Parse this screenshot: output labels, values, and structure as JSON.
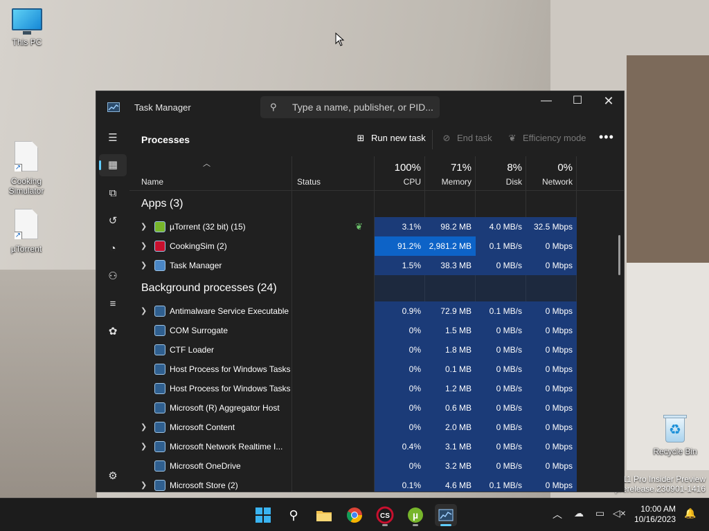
{
  "desktop": {
    "icons": [
      {
        "label": "This PC"
      },
      {
        "label": "Cooking Simulator"
      },
      {
        "label": "µTorrent"
      },
      {
        "label": "Recycle Bin"
      }
    ],
    "watermark": {
      "line1": "11 Pro Insider Preview",
      "line2": "prerelease.230901-1416"
    }
  },
  "window": {
    "title": "Task Manager",
    "search_placeholder": "Type a name, publisher, or PID...",
    "page_title": "Processes",
    "toolbar": {
      "run_new_task": "Run new task",
      "end_task": "End task",
      "efficiency_mode": "Efficiency mode",
      "more": "•••"
    },
    "columns": {
      "name": "Name",
      "status": "Status",
      "cpu": {
        "pct": "100%",
        "label": "CPU"
      },
      "memory": {
        "pct": "71%",
        "label": "Memory"
      },
      "disk": {
        "pct": "8%",
        "label": "Disk"
      },
      "network": {
        "pct": "0%",
        "label": "Network"
      }
    },
    "groups": {
      "apps": "Apps (3)",
      "background": "Background processes (24)"
    },
    "apps": [
      {
        "name": "µTorrent (32 bit) (15)",
        "cpu": "3.1%",
        "mem": "98.2 MB",
        "disk": "4.0 MB/s",
        "net": "32.5 Mbps",
        "expand": true,
        "eco": true,
        "icon_color": "#77b52b"
      },
      {
        "name": "CookingSim (2)",
        "cpu": "91.2%",
        "mem": "2,981.2 MB",
        "disk": "0.1 MB/s",
        "net": "0 Mbps",
        "expand": true,
        "eco": false,
        "icon_color": "#c8102e"
      },
      {
        "name": "Task Manager",
        "cpu": "1.5%",
        "mem": "38.3 MB",
        "disk": "0 MB/s",
        "net": "0 Mbps",
        "expand": true,
        "eco": false,
        "icon_color": "#4a86c5"
      }
    ],
    "background": [
      {
        "name": "Antimalware Service Executable",
        "cpu": "0.9%",
        "mem": "72.9 MB",
        "disk": "0.1 MB/s",
        "net": "0 Mbps",
        "expand": true
      },
      {
        "name": "COM Surrogate",
        "cpu": "0%",
        "mem": "1.5 MB",
        "disk": "0 MB/s",
        "net": "0 Mbps",
        "expand": false
      },
      {
        "name": "CTF Loader",
        "cpu": "0%",
        "mem": "1.8 MB",
        "disk": "0 MB/s",
        "net": "0 Mbps",
        "expand": false
      },
      {
        "name": "Host Process for Windows Tasks",
        "cpu": "0%",
        "mem": "0.1 MB",
        "disk": "0 MB/s",
        "net": "0 Mbps",
        "expand": false
      },
      {
        "name": "Host Process for Windows Tasks",
        "cpu": "0%",
        "mem": "1.2 MB",
        "disk": "0 MB/s",
        "net": "0 Mbps",
        "expand": false
      },
      {
        "name": "Microsoft (R) Aggregator Host",
        "cpu": "0%",
        "mem": "0.6 MB",
        "disk": "0 MB/s",
        "net": "0 Mbps",
        "expand": false
      },
      {
        "name": "Microsoft Content",
        "cpu": "0%",
        "mem": "2.0 MB",
        "disk": "0 MB/s",
        "net": "0 Mbps",
        "expand": true
      },
      {
        "name": "Microsoft Network Realtime I...",
        "cpu": "0.4%",
        "mem": "3.1 MB",
        "disk": "0 MB/s",
        "net": "0 Mbps",
        "expand": true
      },
      {
        "name": "Microsoft OneDrive",
        "cpu": "0%",
        "mem": "3.2 MB",
        "disk": "0 MB/s",
        "net": "0 Mbps",
        "expand": false
      },
      {
        "name": "Microsoft Store (2)",
        "cpu": "0.1%",
        "mem": "4.6 MB",
        "disk": "0.1 MB/s",
        "net": "0 Mbps",
        "expand": true
      }
    ]
  },
  "taskbar": {
    "time": "10:00 AM",
    "date": "10/16/2023",
    "pinned": [
      "start-icon",
      "search-icon",
      "file-explorer-icon",
      "chrome-icon",
      "cookingsim-icon",
      "utorrent-icon",
      "task-manager-icon"
    ]
  },
  "colors": {
    "accent": "#60cdff",
    "heat_low": "#1b3b78",
    "heat_high": "#0d63c7"
  }
}
